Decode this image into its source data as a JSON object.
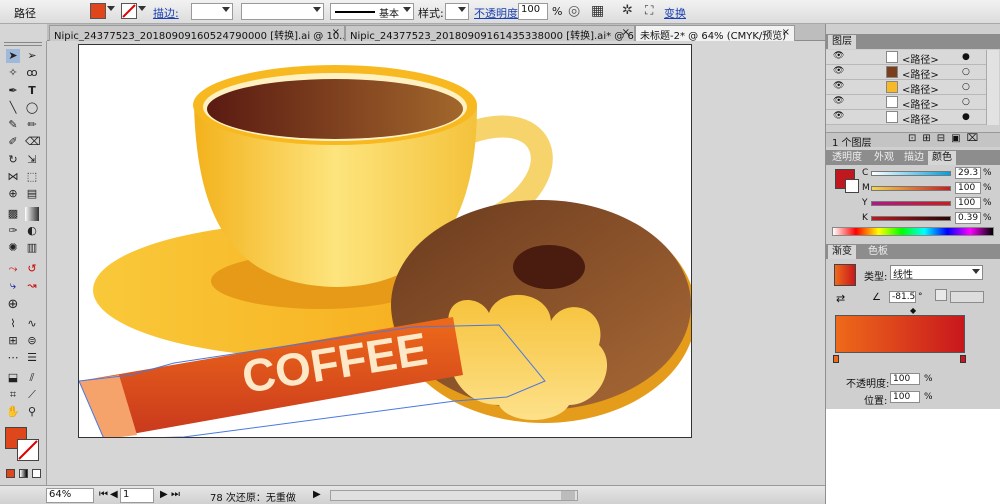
{
  "control_bar": {
    "object_type": "路径",
    "stroke_label": "描边:",
    "stroke_profile": "基本",
    "style_label": "样式:",
    "opacity_label": "不透明度:",
    "opacity_value": "100",
    "opacity_unit": "%",
    "transform_label": "变换",
    "fill_color": "#e0461c"
  },
  "tabs": [
    {
      "label": "Nipic_24377523_20180909160524790000 [转换].ai @ 10..."
    },
    {
      "label": "Nipic_24377523_20180909161435338000 [转换].ai* @ 6..."
    },
    {
      "label": "未标题-2* @ 64% (CMYK/预览)"
    }
  ],
  "artwork": {
    "coffee_text": "COFFEE"
  },
  "status_bar": {
    "zoom": "64%",
    "page": "1",
    "undo_text": "78 次还原：无重做"
  },
  "layers_panel": {
    "title": "图层",
    "rows": [
      {
        "name": "<路径>"
      },
      {
        "name": "<路径>"
      },
      {
        "name": "<路径>"
      },
      {
        "name": "<路径>"
      },
      {
        "name": "<路径>"
      }
    ],
    "footer": "1 个图层"
  },
  "color_panel": {
    "tabs": [
      "透明度",
      "外观",
      "描边",
      "颜色"
    ],
    "channels": [
      {
        "label": "C",
        "value": "29.3"
      },
      {
        "label": "M",
        "value": "100"
      },
      {
        "label": "Y",
        "value": "100"
      },
      {
        "label": "K",
        "value": "0.39"
      }
    ],
    "swatch_color": "#c0181f"
  },
  "gradient_panel": {
    "tabs": [
      "渐变",
      "色板"
    ],
    "type_label": "类型:",
    "type_value": "线性",
    "angle_value": "-81.5",
    "angle_unit": "°",
    "opacity_label": "不透明度:",
    "opacity_value": "100",
    "opacity_unit": "%",
    "position_label": "位置:",
    "position_value": "100",
    "position_unit": "%",
    "start_color": "#ee6a1a",
    "end_color": "#c8171d"
  }
}
